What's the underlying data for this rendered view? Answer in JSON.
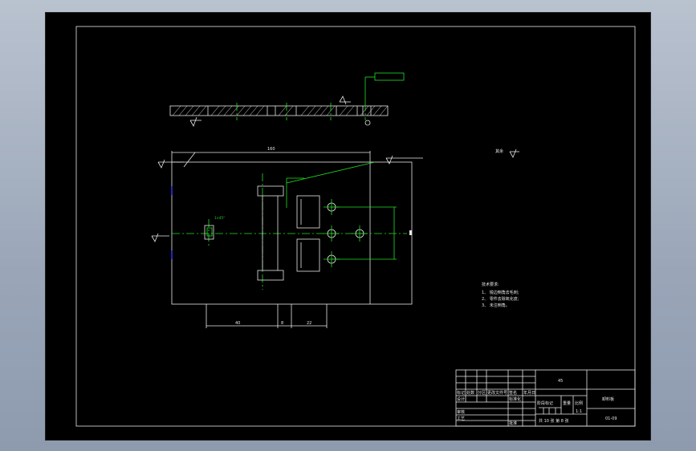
{
  "notes": {
    "heading": "技术要求:",
    "items": [
      "1、 锐边倒角去毛刺;",
      "2、 零件去除氧化皮;",
      "3、 未注倒角。"
    ]
  },
  "roughness": {
    "other_label": "其余"
  },
  "title_block": {
    "material": "45",
    "part_name": "卸料板",
    "drawing_number": "01-09",
    "scale_header": "比例",
    "scale_value": "1:1",
    "mark_header": "阶段标记",
    "weight_header": "重量",
    "sheet_info": "共 10 张  第 8 张",
    "col_headers": [
      "标记",
      "处数",
      "分区",
      "更改文件号",
      "签名",
      "年月日"
    ],
    "row_design": "设计",
    "row_standard": "标准化",
    "row_review": "审核",
    "row_process": "工艺",
    "row_approve": "批准"
  }
}
